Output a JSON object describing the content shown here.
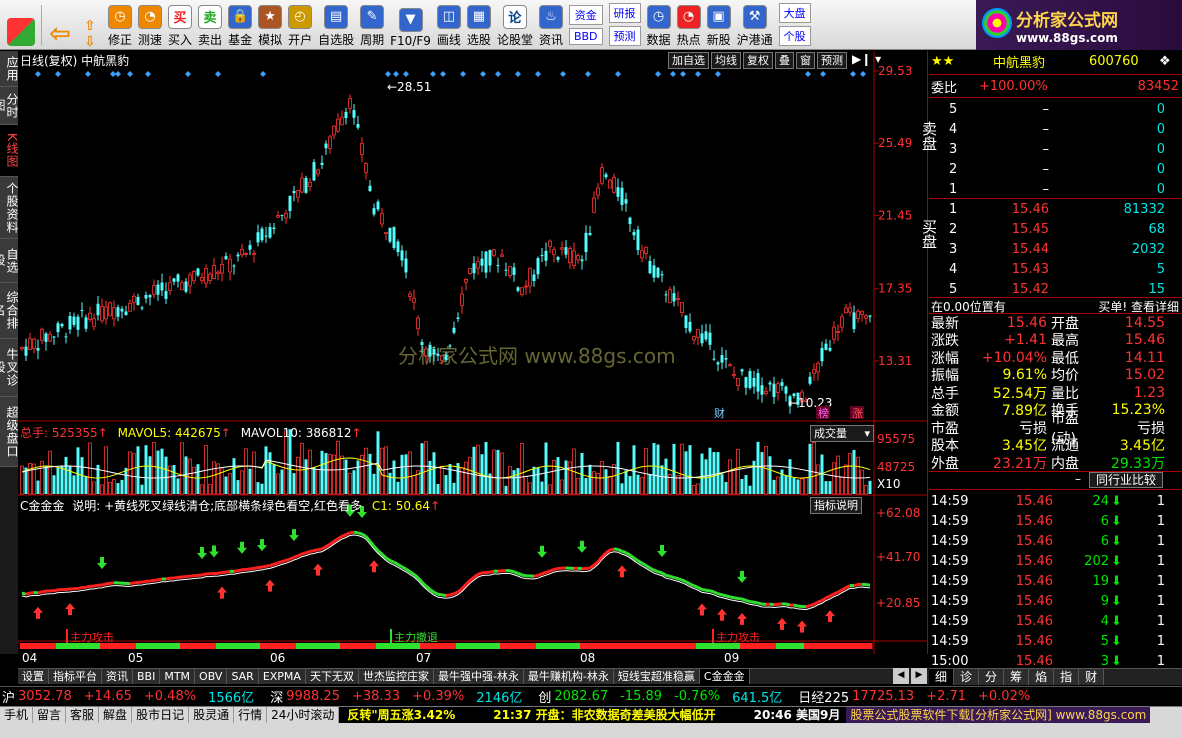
{
  "toolbar": {
    "buttons": [
      {
        "label": "修正",
        "icon": "undo-icon"
      },
      {
        "label": "测速",
        "icon": "clock-icon"
      },
      {
        "label": "买入",
        "icon": "buy-icon",
        "glyph": "买"
      },
      {
        "label": "卖出",
        "icon": "sell-icon",
        "glyph": "卖"
      },
      {
        "label": "基金",
        "icon": "fund-icon"
      },
      {
        "label": "模拟",
        "icon": "hammer-icon"
      },
      {
        "label": "开户",
        "icon": "lock-icon"
      },
      {
        "label": "自选股",
        "icon": "star-icon"
      },
      {
        "label": "周期",
        "icon": "period-icon"
      },
      {
        "label": "F10/F9",
        "icon": "f10-icon"
      },
      {
        "label": "画线",
        "icon": "pen-icon"
      },
      {
        "label": "选股",
        "icon": "filter-icon"
      },
      {
        "label": "论股堂",
        "icon": "forum-icon",
        "glyph": "论"
      },
      {
        "label": "资讯",
        "icon": "news-icon"
      }
    ],
    "small_buttons": [
      [
        "资金",
        "BBD"
      ],
      [
        "研报",
        "预测"
      ]
    ],
    "buttons2": [
      {
        "label": "数据",
        "icon": "pe-icon"
      },
      {
        "label": "热点",
        "icon": "hot-icon"
      },
      {
        "label": "新股",
        "icon": "newstock-icon"
      },
      {
        "label": "沪港通",
        "icon": "hkex-icon"
      }
    ],
    "dapan": [
      "大盘",
      "个股"
    ],
    "brand": {
      "name": "分析家公式网",
      "url": "www.88gs.com"
    }
  },
  "leftbar": [
    {
      "label": "应用"
    },
    {
      "label": "分时图"
    },
    {
      "label": "K线图",
      "active": true
    },
    {
      "label": "个股资料"
    },
    {
      "label": "自选股"
    },
    {
      "label": "综合排名"
    },
    {
      "label": "牛叉诊股"
    },
    {
      "label": "超级盘口"
    }
  ],
  "chart": {
    "header": "日线(复权) 中航黑豹",
    "header_buttons": [
      "加自选",
      "均线",
      "复权",
      "叠",
      "窗",
      "预测"
    ],
    "price_ticks": [
      "29.53",
      "25.49",
      "21.45",
      "17.35",
      "13.31"
    ],
    "high_label": "28.51",
    "low_label": "10.23",
    "watermark": "分析家公式网 www.88gs.com",
    "markers": [
      {
        "text": "财",
        "color": "#7fd0ff"
      },
      {
        "text": "榜",
        "color": "#ff66ff"
      },
      {
        "text": "涨",
        "color": "#ff5a5a"
      }
    ],
    "volume": {
      "label": "总手: 525355",
      "mavol5": "MAVOL5: 442675",
      "mavol10": "MAVOL10: 386812",
      "dropdown": "成交量",
      "ticks": [
        "95575",
        "48725",
        "X10"
      ]
    },
    "indicator": {
      "label": "C金金金",
      "desc": "说明: +黄线死叉绿线清仓;底部横条绿色看空,红色看多",
      "c1": "C1: 50.64",
      "button": "指标说明",
      "ticks": [
        "+62.08",
        "+41.70",
        "+20.85"
      ],
      "band_labels": [
        "主力攻击",
        "主力撤退",
        "主力攻击"
      ]
    },
    "months": [
      "04",
      "05",
      "06",
      "07",
      "08",
      "09"
    ]
  },
  "bottom_tabs": [
    "设置",
    "指标平台",
    "资讯",
    "BBI",
    "MTM",
    "OBV",
    "SAR",
    "EXPMA",
    "天下无双",
    "世杰监控庄家",
    "最牛强中强-林永",
    "最牛赚机构-林永",
    "短线宝超准稳赢",
    "C金金金"
  ],
  "right": {
    "stock_name": "中航黑豹",
    "stock_code": "600760",
    "weibi": {
      "label": "委比",
      "pct": "+100.00%",
      "diff": "83452"
    },
    "sell": [
      {
        "lv": "5",
        "p": "–",
        "v": "0"
      },
      {
        "lv": "4",
        "p": "–",
        "v": "0"
      },
      {
        "lv": "3",
        "p": "–",
        "v": "0"
      },
      {
        "lv": "2",
        "p": "–",
        "v": "0"
      },
      {
        "lv": "1",
        "p": "–",
        "v": "0"
      }
    ],
    "sell_label": "卖盘",
    "buy": [
      {
        "lv": "1",
        "p": "15.46",
        "v": "81332"
      },
      {
        "lv": "2",
        "p": "15.45",
        "v": "68"
      },
      {
        "lv": "3",
        "p": "15.44",
        "v": "2032"
      },
      {
        "lv": "4",
        "p": "15.43",
        "v": "5"
      },
      {
        "lv": "5",
        "p": "15.42",
        "v": "15"
      }
    ],
    "buy_label": "买盘",
    "position_line": {
      "left": "在0.00位置有",
      "right": "买单! 查看详细"
    },
    "quote": [
      {
        "k1": "最新",
        "v1": "15.46",
        "c1": "red",
        "k2": "开盘",
        "v2": "14.55",
        "c2": "red"
      },
      {
        "k1": "涨跌",
        "v1": "+1.41",
        "c1": "red",
        "k2": "最高",
        "v2": "15.46",
        "c2": "red"
      },
      {
        "k1": "涨幅",
        "v1": "+10.04%",
        "c1": "red",
        "k2": "最低",
        "v2": "14.11",
        "c2": "red"
      },
      {
        "k1": "振幅",
        "v1": "9.61%",
        "c1": "yellow",
        "k2": "均价",
        "v2": "15.02",
        "c2": "red"
      },
      {
        "k1": "总手",
        "v1": "52.54万",
        "c1": "yellow",
        "k2": "量比",
        "v2": "1.23",
        "c2": "red"
      },
      {
        "k1": "金额",
        "v1": "7.89亿",
        "c1": "yellow",
        "k2": "换手",
        "v2": "15.23%",
        "c2": "yellow"
      },
      {
        "k1": "市盈",
        "v1": "亏损",
        "c1": "white",
        "k2": "市盈(动)",
        "v2": "亏损",
        "c2": "white"
      },
      {
        "k1": "股本",
        "v1": "3.45亿",
        "c1": "yellow",
        "k2": "流通",
        "v2": "3.45亿",
        "c2": "yellow"
      },
      {
        "k1": "外盘",
        "v1": "23.21万",
        "c1": "red",
        "k2": "内盘",
        "v2": "29.33万",
        "c2": "green"
      }
    ],
    "industry_button": "同行业比较",
    "ticks": [
      {
        "t": "14:59",
        "p": "15.46",
        "v": "24",
        "n": "1"
      },
      {
        "t": "14:59",
        "p": "15.46",
        "v": "6",
        "n": "1"
      },
      {
        "t": "14:59",
        "p": "15.46",
        "v": "6",
        "n": "1"
      },
      {
        "t": "14:59",
        "p": "15.46",
        "v": "202",
        "n": "1"
      },
      {
        "t": "14:59",
        "p": "15.46",
        "v": "19",
        "n": "1"
      },
      {
        "t": "14:59",
        "p": "15.46",
        "v": "9",
        "n": "1"
      },
      {
        "t": "14:59",
        "p": "15.46",
        "v": "4",
        "n": "1"
      },
      {
        "t": "14:59",
        "p": "15.46",
        "v": "5",
        "n": "1"
      },
      {
        "t": "15:00",
        "p": "15.46",
        "v": "3",
        "n": "1"
      }
    ],
    "tabs": [
      "细",
      "诊",
      "分",
      "筹",
      "焰",
      "指",
      "财"
    ]
  },
  "index_bar": [
    {
      "k": "沪",
      "v": "3052.78",
      "c": "red"
    },
    {
      "v": "+14.65",
      "c": "red"
    },
    {
      "v": "+0.48%",
      "c": "red"
    },
    {
      "v": "1566亿",
      "c": "cyan"
    },
    {
      "k": "深",
      "v": "9988.25",
      "c": "red"
    },
    {
      "v": "+38.33",
      "c": "red"
    },
    {
      "v": "+0.39%",
      "c": "red"
    },
    {
      "v": "2146亿",
      "c": "cyan"
    },
    {
      "k": "创",
      "v": "2082.67",
      "c": "green"
    },
    {
      "v": "-15.89",
      "c": "green"
    },
    {
      "v": "-0.76%",
      "c": "green"
    },
    {
      "v": "641.5亿",
      "c": "cyan"
    },
    {
      "k": "日经225",
      "v": "17725.13",
      "c": "red"
    },
    {
      "v": "+2.71",
      "c": "red"
    },
    {
      "v": "+0.02%",
      "c": "red"
    }
  ],
  "status": {
    "items": [
      "手机",
      "留言",
      "客服",
      "解盘",
      "股市日记",
      "股灵通",
      "行情",
      "24小时滚动"
    ],
    "news1": "反转\"周五涨3.42%",
    "news2": "21:37 开盘：非农数据奇差美股大幅低开",
    "news3": "20:46 美国9月",
    "ad": "股票公式股票软件下载[分析家公式网] www.88gs.com"
  }
}
